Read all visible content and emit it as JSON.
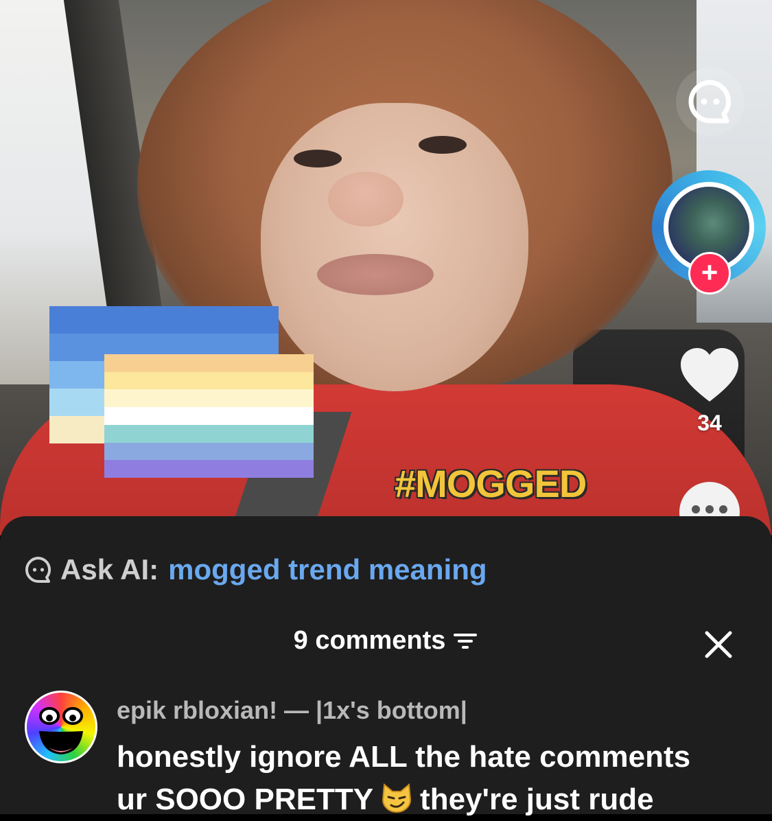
{
  "video": {
    "hashtag_overlay": "#MOGGED",
    "flags": [
      {
        "stripes": [
          "#4a7fd8",
          "#5a92e0",
          "#7eb6ee",
          "#a8d9f2",
          "#f7ebc4"
        ]
      },
      {
        "stripes": [
          "#f7cf90",
          "#fce79c",
          "#fff5cc",
          "#ffffff",
          "#8fd4d2",
          "#8aa9e0",
          "#8f7ee0"
        ]
      }
    ]
  },
  "right_rail": {
    "ai_icon": "ai-chat-icon",
    "follow_label": "+",
    "like_count": "34",
    "colors": {
      "follow": "#fe2c55",
      "like": "#f2f2f2"
    }
  },
  "comments_sheet": {
    "ask_ai": {
      "label": "Ask AI:",
      "query": "mogged trend meaning",
      "query_color": "#6aa8ef"
    },
    "count_label": "9 comments",
    "comments": [
      {
        "username": "epik rbloxian! — |1x's bottom|",
        "text_line1": "honestly ignore ALL the hate comments",
        "text_line2_a": "ur SOOO PRETTY",
        "text_line2_b": "they're just rude",
        "emoji": "smirking-cat-icon"
      }
    ]
  }
}
